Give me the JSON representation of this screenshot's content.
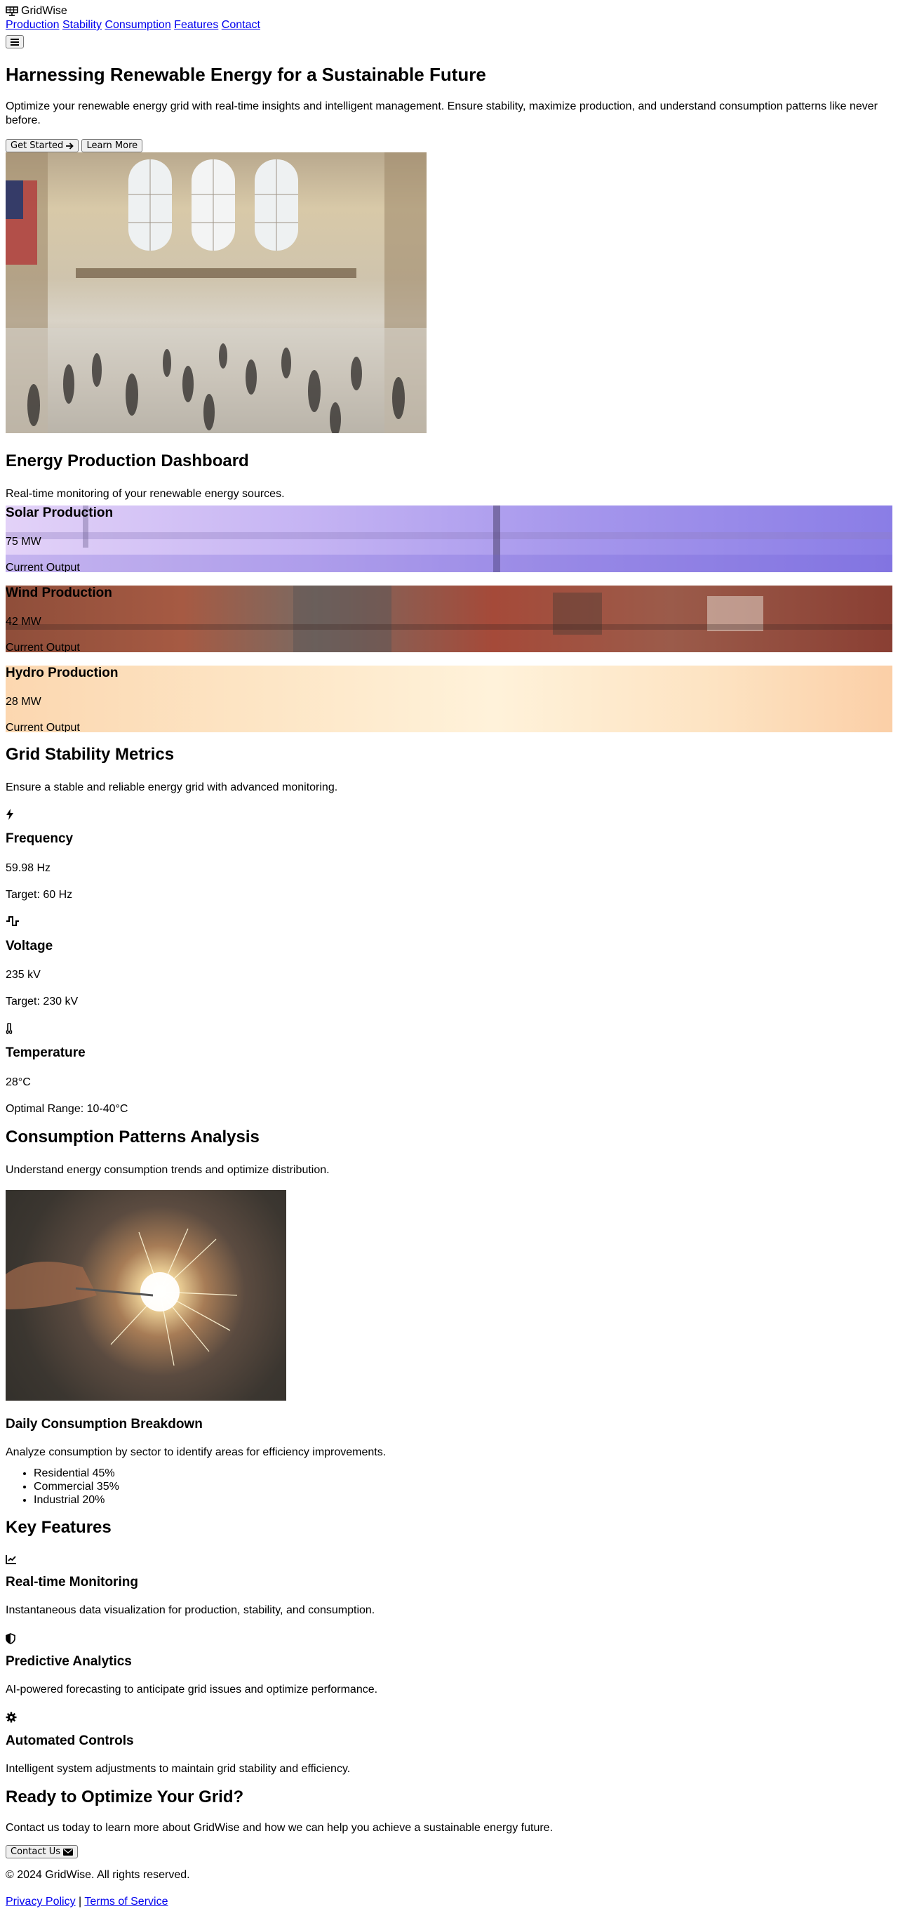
{
  "header": {
    "brand": "GridWise",
    "nav": [
      "Production",
      "Stability",
      "Consumption",
      "Features",
      "Contact"
    ],
    "menu_icon": "hamburger-icon"
  },
  "hero": {
    "title": "Harnessing Renewable Energy for a Sustainable Future",
    "text": "Optimize your renewable energy grid with real-time insights and intelligent management. Ensure stability, maximize production, and understand consumption patterns like never before.",
    "primary_button": "Get Started",
    "secondary_button": "Learn More"
  },
  "production": {
    "title": "Energy Production Dashboard",
    "subtitle": "Real-time monitoring of your renewable energy sources.",
    "cards": [
      {
        "title": "Solar Production",
        "value": "75 MW",
        "caption": "Current Output"
      },
      {
        "title": "Wind Production",
        "value": "42 MW",
        "caption": "Current Output"
      },
      {
        "title": "Hydro Production",
        "value": "28 MW",
        "caption": "Current Output"
      }
    ]
  },
  "stability": {
    "title": "Grid Stability Metrics",
    "subtitle": "Ensure a stable and reliable energy grid with advanced monitoring.",
    "metrics": [
      {
        "icon": "bolt-icon",
        "title": "Frequency",
        "value": "59.98 Hz",
        "target": "Target: 60 Hz"
      },
      {
        "icon": "waveform-icon",
        "title": "Voltage",
        "value": "235 kV",
        "target": "Target: 230 kV"
      },
      {
        "icon": "thermometer-icon",
        "title": "Temperature",
        "value": "28°C",
        "target": "Optimal Range: 10-40°C"
      }
    ]
  },
  "consumption": {
    "title": "Consumption Patterns Analysis",
    "subtitle": "Understand energy consumption trends and optimize distribution.",
    "breakdown_title": "Daily Consumption Breakdown",
    "breakdown_text": "Analyze consumption by sector to identify areas for efficiency improvements.",
    "sectors": [
      "Residential 45%",
      "Commercial 35%",
      "Industrial 20%"
    ]
  },
  "features": {
    "title": "Key Features",
    "items": [
      {
        "icon": "chart-line-icon",
        "title": "Real-time Monitoring",
        "text": "Instantaneous data visualization for production, stability, and consumption."
      },
      {
        "icon": "shield-icon",
        "title": "Predictive Analytics",
        "text": "AI-powered forecasting to anticipate grid issues and optimize performance."
      },
      {
        "icon": "gear-icon",
        "title": "Automated Controls",
        "text": "Intelligent system adjustments to maintain grid stability and efficiency."
      }
    ]
  },
  "contact": {
    "title": "Ready to Optimize Your Grid?",
    "text": "Contact us today to learn more about GridWise and how we can help you achieve a sustainable energy future.",
    "button": "Contact Us"
  },
  "footer": {
    "copyright": "© 2024 GridWise. All rights reserved.",
    "privacy": "Privacy Policy",
    "separator": "|",
    "terms": "Terms of Service"
  }
}
